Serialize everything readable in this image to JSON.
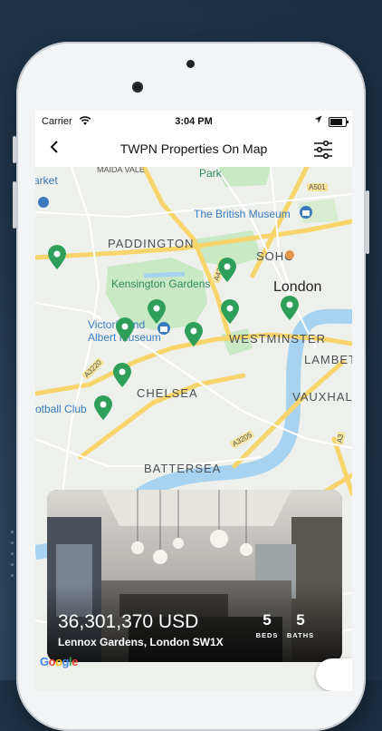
{
  "status_bar": {
    "carrier": "Carrier",
    "time": "3:04 PM"
  },
  "nav": {
    "title": "TWPN Properties On Map",
    "back_icon": "chevron-left-icon",
    "filter_icon": "sliders-icon"
  },
  "map": {
    "labels": {
      "maida_vale": "MAIDA VALE",
      "park": "Park",
      "market": "arket",
      "british_museum": "The British Museum",
      "paddington": "PADDINGTON",
      "soho": "SOHO",
      "kensington_gardens": "Kensington Gardens",
      "london": "London",
      "victoria_albert": "Victoria and Albert Museum",
      "westminster": "WESTMINSTER",
      "lambeth": "LAMBET",
      "chelsea": "CHELSEA",
      "vauxhall": "VAUXHAL",
      "football_club": "otball Club",
      "battersea": "BATTERSEA",
      "road_a501": "A501",
      "road_a4202": "A4202",
      "road_a3220": "A3220",
      "road_a3205": "A3205",
      "road_a3": "A3"
    },
    "attribution": "Google",
    "colors": {
      "pin": "#2e9e5b",
      "park": "#c9e8c4",
      "water": "#a8d3f0",
      "road_major": "#f7d56b"
    }
  },
  "property_card": {
    "price": "36,301,370 USD",
    "address": "Lennox Gardens, London SW1X",
    "beds": {
      "value": "5",
      "label": "BEDS"
    },
    "baths": {
      "value": "5",
      "label": "BATHS"
    }
  }
}
